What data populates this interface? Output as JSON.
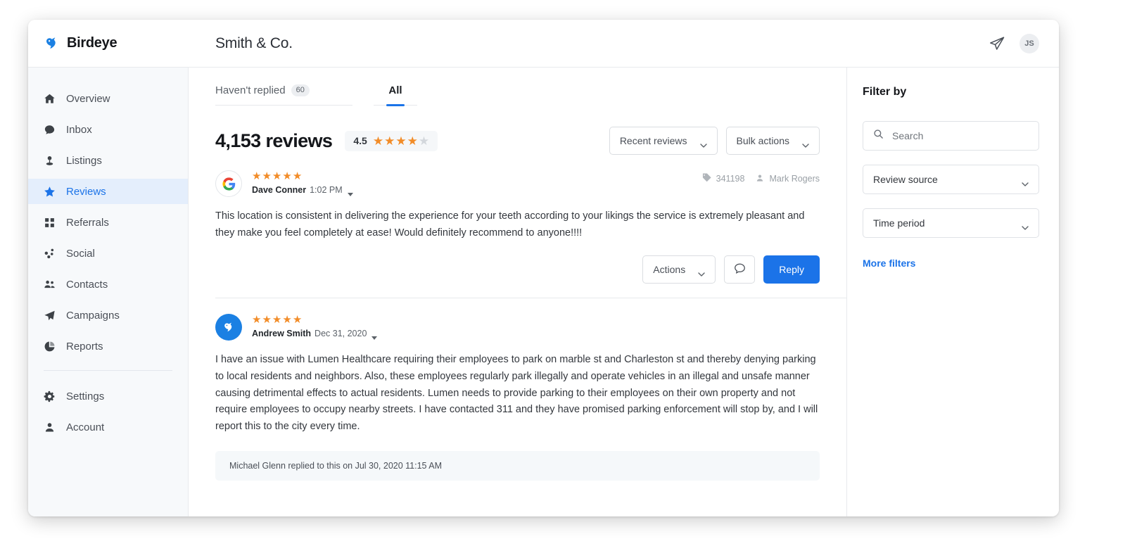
{
  "app": {
    "brand_name": "Birdeye",
    "brand_logo_icon": "birdeye-bird-logo",
    "account_title": "Smith & Co.",
    "send_icon": "paper-plane-icon",
    "avatar_initials": "JS"
  },
  "sidebar": {
    "items": [
      {
        "label": "Overview",
        "icon": "home-icon",
        "active": false
      },
      {
        "label": "Inbox",
        "icon": "chat-bubble-icon",
        "active": false
      },
      {
        "label": "Listings",
        "icon": "map-pin-icon",
        "active": false
      },
      {
        "label": "Reviews",
        "icon": "star-icon",
        "active": true
      },
      {
        "label": "Referrals",
        "icon": "referrals-icon",
        "active": false
      },
      {
        "label": "Social",
        "icon": "share-nodes-icon",
        "active": false
      },
      {
        "label": "Contacts",
        "icon": "people-icon",
        "active": false
      },
      {
        "label": "Campaigns",
        "icon": "paper-plane-icon",
        "active": false
      },
      {
        "label": "Reports",
        "icon": "pie-chart-icon",
        "active": false
      }
    ],
    "footer_items": [
      {
        "label": "Settings",
        "icon": "gear-icon"
      },
      {
        "label": "Account",
        "icon": "person-icon"
      }
    ]
  },
  "main": {
    "tabs": [
      {
        "label": "Haven't replied",
        "badge": "60",
        "active": false
      },
      {
        "label": "All",
        "badge": "",
        "active": true
      }
    ],
    "header": {
      "count_label": "4,153 reviews",
      "rating_value": "4.5",
      "stars_filled": 4,
      "stars_total": 5,
      "sort_button": "Recent reviews",
      "bulk_button": "Bulk actions",
      "chevron_icon": "chevron-down-icon"
    },
    "reviews": [
      {
        "source_icon": "google-icon",
        "stars": 5,
        "author": "Dave Conner",
        "timestamp": "1:02 PM",
        "tag_icon": "tag-icon",
        "tag_id": "341198",
        "assignee_icon": "person-icon",
        "assignee": "Mark Rogers",
        "text": "This location is consistent in delivering the experience for your teeth according to your likings the service is extremely pleasant and they make you feel completely at ease! Would definitely recommend to anyone!!!!",
        "actions_button": "Actions",
        "comment_icon": "comment-bubble-icon",
        "reply_button": "Reply"
      },
      {
        "source_icon": "birdeye-icon",
        "stars": 5,
        "author": "Andrew Smith",
        "timestamp": "Dec 31, 2020",
        "tag_icon": "",
        "tag_id": "",
        "assignee_icon": "",
        "assignee": "",
        "text": "I have an issue with Lumen Healthcare requiring their employees to park on marble st and Charleston st and thereby denying parking to local residents and neighbors. Also, these employees regularly park illegally and operate vehicles in an illegal and unsafe manner causing detrimental effects to actual residents. Lumen needs to provide parking to their employees on their own property and not require employees to occupy nearby streets. I have contacted 311 and they have promised parking enforcement will stop by, and I will report this to the city every time.",
        "reply_note": "Michael Glenn replied to this on Jul 30, 2020 11:15 AM"
      }
    ]
  },
  "filters": {
    "title": "Filter by",
    "search_icon": "search-icon",
    "search_placeholder": "Search",
    "search_value": "",
    "selects": [
      {
        "label": "Review source",
        "icon": "chevron-down-icon"
      },
      {
        "label": "Time period",
        "icon": "chevron-down-icon"
      }
    ],
    "more_filters": "More filters"
  },
  "colors": {
    "accent": "#1b73e8",
    "star": "#f28c28",
    "star_empty": "#d3d7dc",
    "sidebar_bg": "#f7f9fb",
    "active_nav_bg": "#e4eefc"
  }
}
